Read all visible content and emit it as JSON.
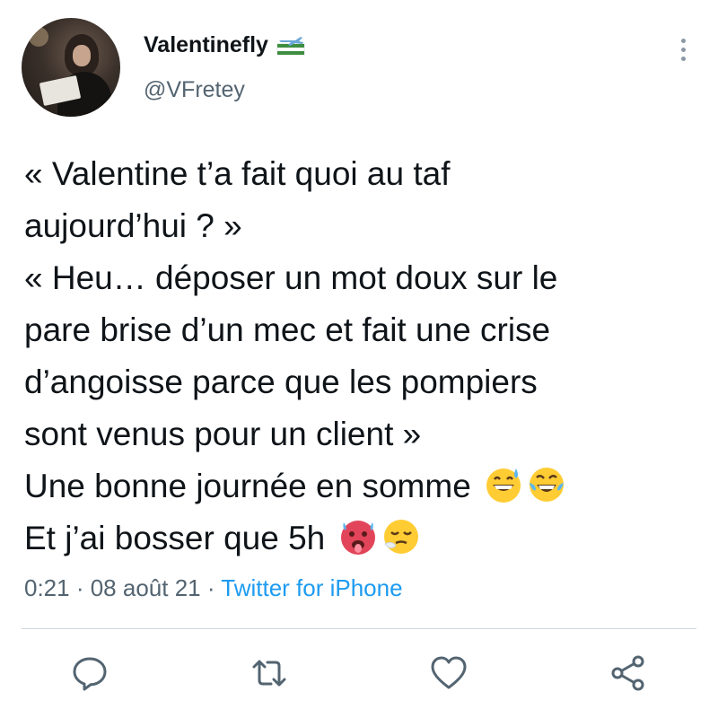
{
  "author": {
    "display_name": "Valentinefly",
    "handle": "@VFretey"
  },
  "tweet": {
    "lines": [
      "« Valentine t’a fait quoi au taf",
      "aujourd’hui ? »",
      "« Heu… déposer un mot doux sur le",
      "pare brise d’un mec et fait une crise",
      "d’angoisse parce que les pompiers",
      "sont venus pour un client »",
      "Une bonne journée en somme",
      "Et j’ai bosser que 5h"
    ]
  },
  "meta": {
    "time": "0:21",
    "separator": " · ",
    "date": "08 août 21",
    "source": "Twitter for iPhone"
  },
  "icons": {
    "name_badge": "airplane-flag-icon",
    "menu": "more-vertical-icon",
    "reply": "reply-icon",
    "retweet": "retweet-icon",
    "like": "heart-icon",
    "share": "share-icon",
    "line7_emojis": [
      "grinning-sweat-emoji",
      "tears-of-joy-emoji"
    ],
    "line8_emojis": [
      "hot-face-emoji",
      "relieved-sleepy-emoji"
    ]
  },
  "colors": {
    "text": "#0f1419",
    "secondary": "#536471",
    "link": "#1d9bf0",
    "divider": "#cfd9de"
  }
}
